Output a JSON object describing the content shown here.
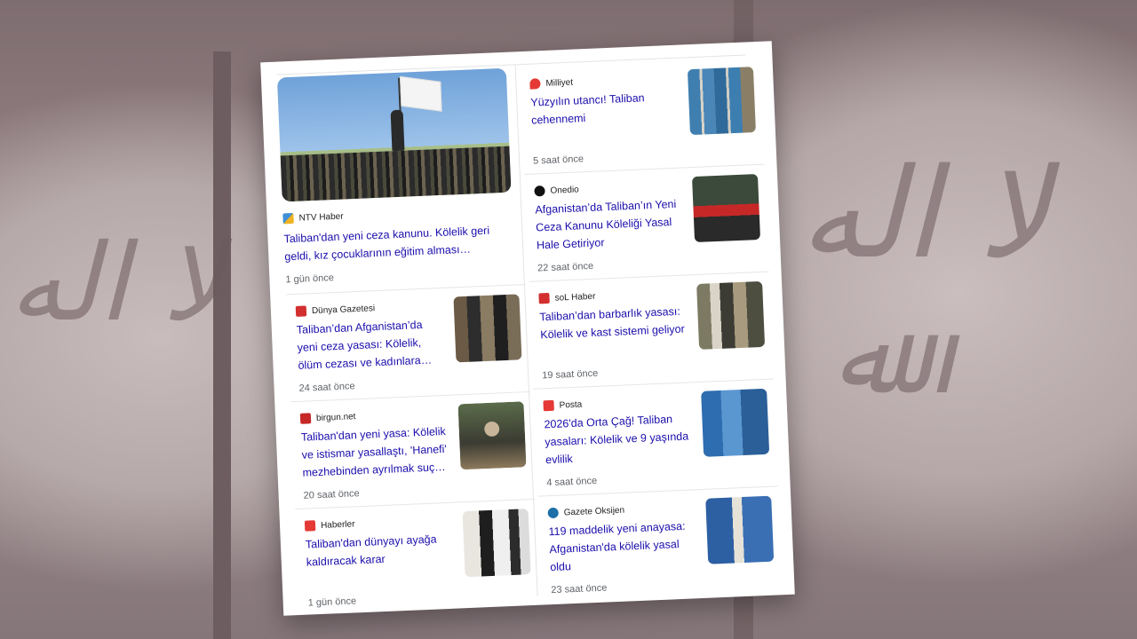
{
  "left_column": {
    "hero": {
      "source": "NTV Haber",
      "title": "Taliban'dan yeni ceza kanunu. Kölelik geri geldi, kız çocuklarının eğitim alması…",
      "time": "1 gün önce"
    },
    "items": [
      {
        "source": "Dünya Gazetesi",
        "title": "Taliban’dan Afganistan’da yeni ceza yasası: Kölelik, ölüm cezası ve kadınlara…",
        "time": "24 saat önce",
        "logo_color": "#d32f2f"
      },
      {
        "source": "birgun.net",
        "title": "Taliban'dan yeni yasa: Kölelik ve istismar yasallaştı, 'Hanefi' mezhebinden ayrılmak suç…",
        "time": "20 saat önce",
        "logo_color": "#c62828"
      },
      {
        "source": "Haberler",
        "title": "Taliban'dan dünyayı ayağa kaldıracak karar",
        "time": "1 gün önce",
        "logo_color": "#e53935"
      }
    ]
  },
  "right_column": {
    "items": [
      {
        "source": "Milliyet",
        "title": "Yüzyılın utancı! Taliban cehennemi",
        "time": "5 saat önce",
        "logo_color": "#e53935"
      },
      {
        "source": "Onedio",
        "title": "Afganistan’da Taliban’ın Yeni Ceza Kanunu Köleliği Yasal Hale Getiriyor",
        "time": "22 saat önce",
        "logo_color": "#111111"
      },
      {
        "source": "soL Haber",
        "title": "Taliban’dan barbarlık yasası: Kölelik ve kast sistemi geliyor",
        "time": "19 saat önce",
        "logo_color": "#d32f2f"
      },
      {
        "source": "Posta",
        "title": "2026'da Orta Çağ! Taliban yasaları: Kölelik ve 9 yaşında evlilik",
        "time": "4 saat önce",
        "logo_color": "#e53935"
      },
      {
        "source": "Gazete Oksijen",
        "title": "119 maddelik yeni anayasa: Afganistan'da kölelik yasal oldu",
        "time": "23 saat önce",
        "logo_color": "#1e6fa8"
      }
    ]
  },
  "colors": {
    "link": "#1a0dab",
    "meta": "#5f6368",
    "background": "#8c7b7d"
  }
}
